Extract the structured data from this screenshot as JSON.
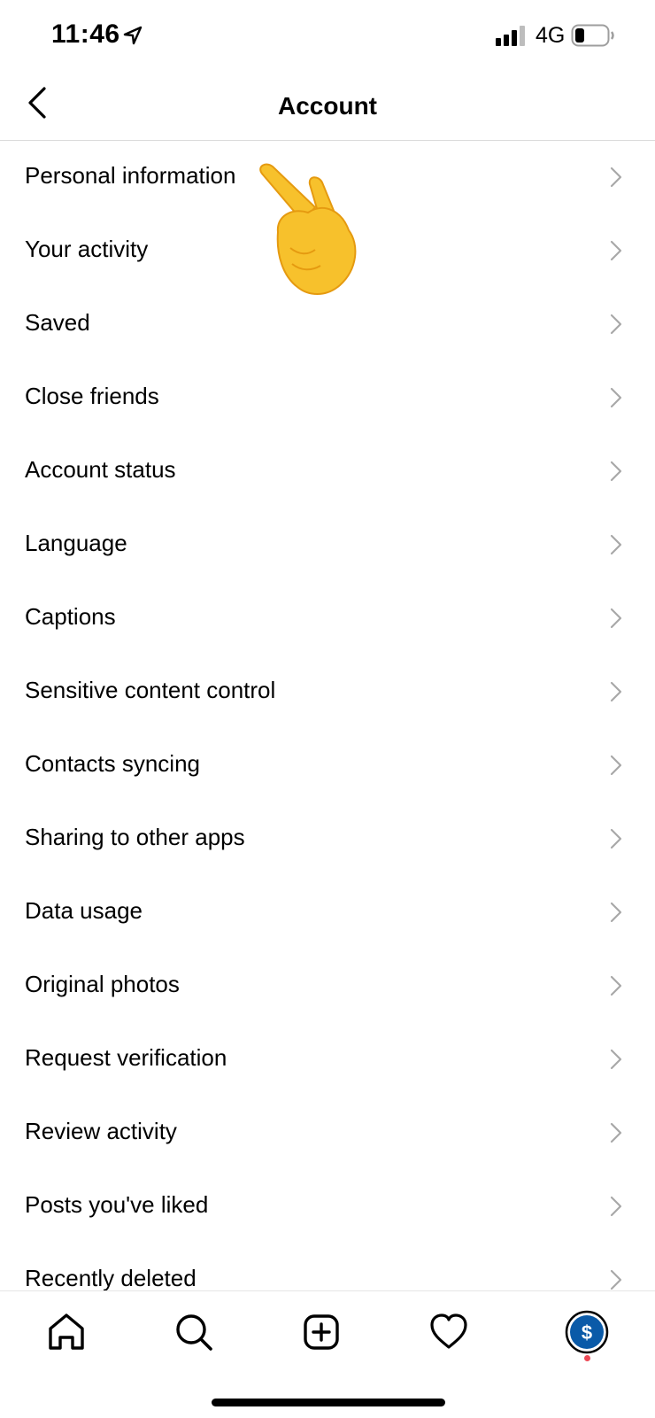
{
  "status_bar": {
    "time": "11:46",
    "network": "4G"
  },
  "header": {
    "title": "Account"
  },
  "menu_items": [
    {
      "label": "Personal information"
    },
    {
      "label": "Your activity"
    },
    {
      "label": "Saved"
    },
    {
      "label": "Close friends"
    },
    {
      "label": "Account status"
    },
    {
      "label": "Language"
    },
    {
      "label": "Captions"
    },
    {
      "label": "Sensitive content control"
    },
    {
      "label": "Contacts syncing"
    },
    {
      "label": "Sharing to other apps"
    },
    {
      "label": "Data usage"
    },
    {
      "label": "Original photos"
    },
    {
      "label": "Request verification"
    },
    {
      "label": "Review activity"
    },
    {
      "label": "Posts you've liked"
    },
    {
      "label": "Recently deleted"
    }
  ],
  "tab_bar": {
    "tabs": [
      "home-icon",
      "search-icon",
      "new-post-icon",
      "heart-icon",
      "profile-avatar"
    ],
    "avatar_color": "#0a5aa8",
    "notification_color": "#ed4956"
  },
  "overlay": {
    "emoji": "pointing-hand-emoji"
  }
}
